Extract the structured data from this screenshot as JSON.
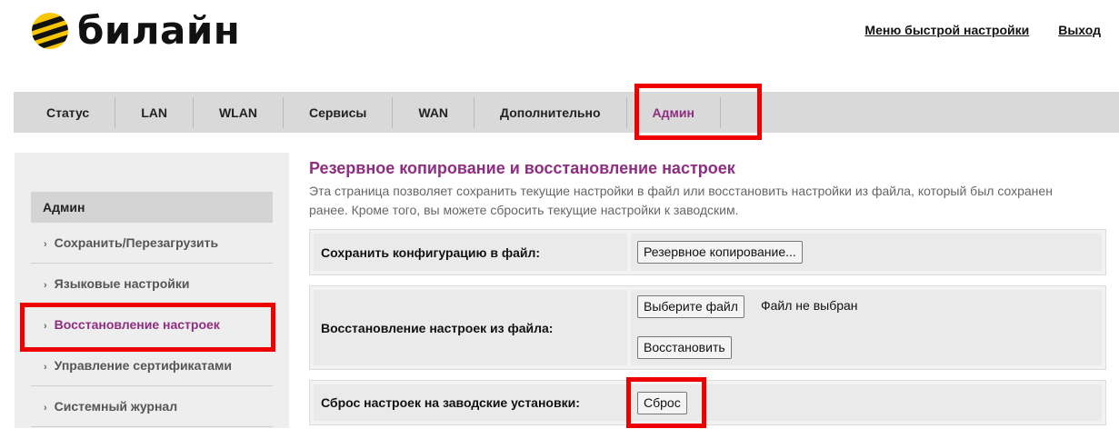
{
  "header": {
    "brand": "билайн",
    "quick_setup_link": "Меню быстрой настройки",
    "logout_link": "Выход",
    "brand_colors": {
      "yellow": "#f7c600",
      "black": "#111111"
    }
  },
  "nav": {
    "items": [
      "Статус",
      "LAN",
      "WLAN",
      "Сервисы",
      "WAN",
      "Дополнительно",
      "Админ"
    ],
    "active": "Админ",
    "active_color": "#8f2d82"
  },
  "sidebar": {
    "heading": "Админ",
    "items": [
      {
        "label": "Сохранить/Перезагрузить"
      },
      {
        "label": "Языковые настройки"
      },
      {
        "label": "Восстановление настроек"
      },
      {
        "label": "Управление сертификатами"
      },
      {
        "label": "Системный журнал"
      }
    ],
    "active": "Восстановление настроек",
    "bullet": "›"
  },
  "main": {
    "title": "Резервное копирование и восстановление настроек",
    "description": "Эта страница позволяет сохранить текущие настройки в файл или восстановить настройки из файла, который был сохранен ранее. Кроме того, вы можете сбросить текущие настройки к заводским.",
    "backup": {
      "label": "Сохранить конфигурацию в файл:",
      "button": "Резервное копирование..."
    },
    "restore": {
      "label": "Восстановление настроек из файла:",
      "choose_file_button": "Выберите файл",
      "file_status": "Файл не выбран",
      "restore_button": "Восстановить"
    },
    "reset": {
      "label": "Сброс настроек на заводские установки:",
      "button": "Сброс"
    }
  },
  "highlight_color": "#ee0000"
}
